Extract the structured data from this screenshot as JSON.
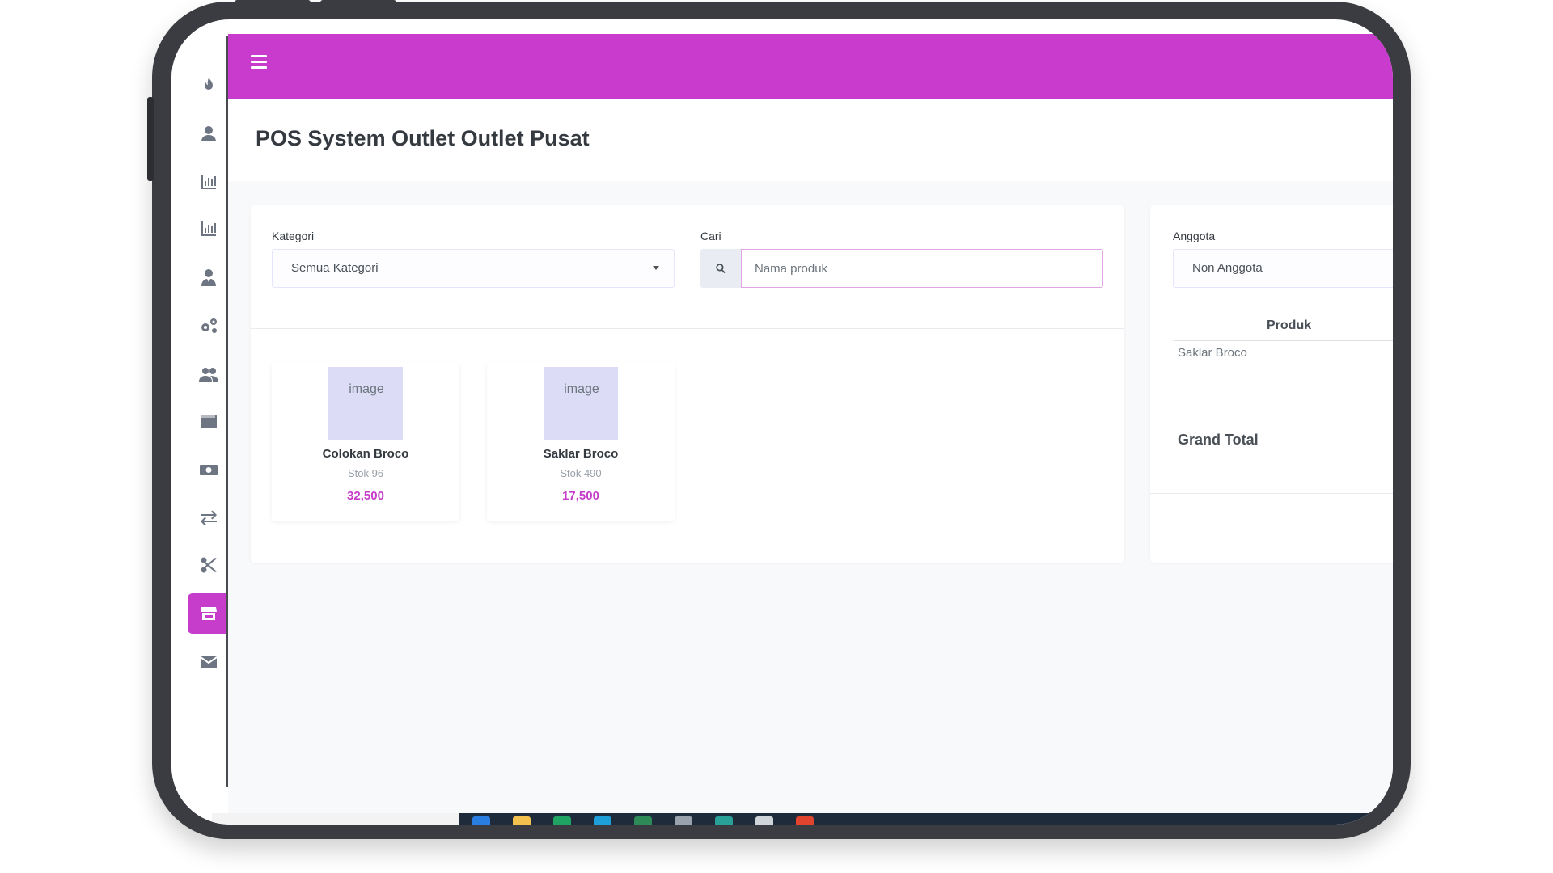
{
  "app": {
    "page_title": "POS System Outlet Outlet Pusat",
    "accent_color": "#c93bcc"
  },
  "sidebar": {
    "items": [
      {
        "name": "fire-icon",
        "active": false
      },
      {
        "name": "user-icon",
        "active": false
      },
      {
        "name": "chart-bar-icon",
        "active": false
      },
      {
        "name": "chart-bar-icon",
        "active": false
      },
      {
        "name": "user-tie-icon",
        "active": false
      },
      {
        "name": "cogs-icon",
        "active": false
      },
      {
        "name": "users-icon",
        "active": false
      },
      {
        "name": "wallet-icon",
        "active": false
      },
      {
        "name": "money-bill-icon",
        "active": false
      },
      {
        "name": "exchange-icon",
        "active": false
      },
      {
        "name": "cut-icon",
        "active": false
      },
      {
        "name": "store-icon",
        "active": true
      },
      {
        "name": "envelope-icon",
        "active": false
      }
    ]
  },
  "filters": {
    "kategori_label": "Kategori",
    "kategori_value": "Semua Kategori",
    "cari_label": "Cari",
    "search_placeholder": "Nama produk"
  },
  "products": [
    {
      "image_alt": "image",
      "name": "Colokan Broco",
      "stock": "Stok 96",
      "price": "32,500"
    },
    {
      "image_alt": "image",
      "name": "Saklar Broco",
      "stock": "Stok 490",
      "price": "17,500"
    }
  ],
  "cart": {
    "anggota_label": "Anggota",
    "anggota_value": "Non Anggota",
    "column_produk": "Produk",
    "items": [
      {
        "name": "Saklar Broco"
      }
    ],
    "grand_total_label": "Grand Total"
  }
}
